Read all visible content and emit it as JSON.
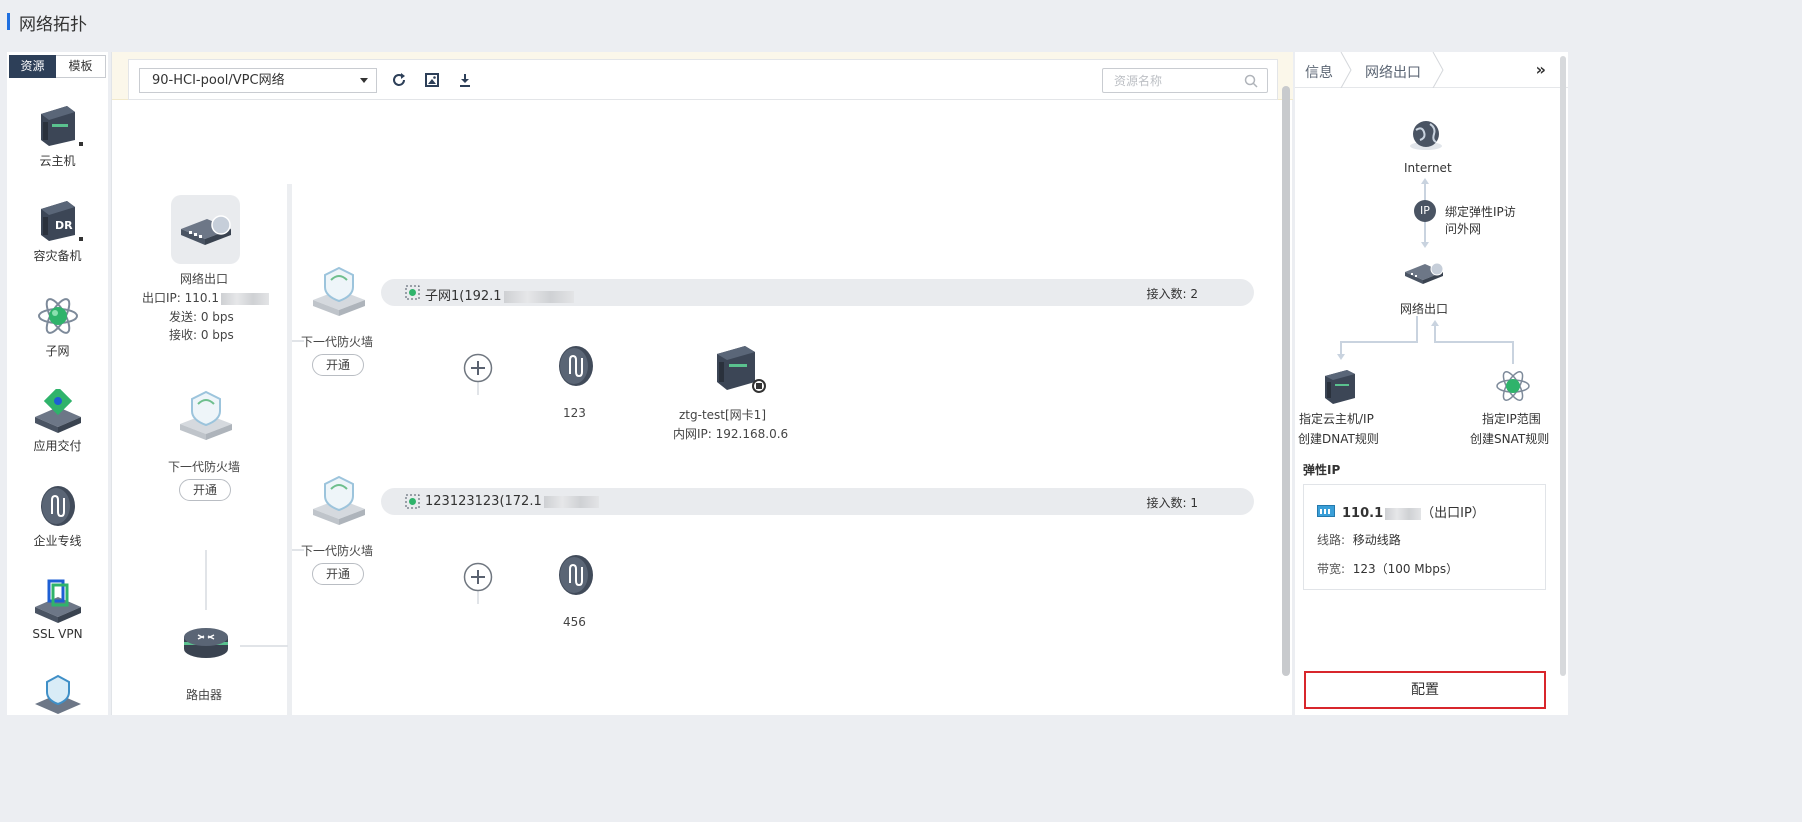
{
  "page": {
    "title": "网络拓扑"
  },
  "left": {
    "tabs": [
      {
        "label": "资源",
        "active": true
      },
      {
        "label": "模板",
        "active": false
      }
    ],
    "resources": [
      {
        "label": "云主机",
        "icon": "server-icon"
      },
      {
        "label": "容灾备机",
        "icon": "dr-server-icon"
      },
      {
        "label": "子网",
        "icon": "subnet-icon"
      },
      {
        "label": "应用交付",
        "icon": "app-delivery-icon"
      },
      {
        "label": "企业专线",
        "icon": "enterprise-line-icon"
      },
      {
        "label": "SSL VPN",
        "icon": "ssl-vpn-icon"
      }
    ]
  },
  "toolbar": {
    "select_value": "90-HCI-pool/VPC网络",
    "search_placeholder": "资源名称"
  },
  "topology": {
    "gateway": {
      "name": "网络出口",
      "ip_label": "出口IP: 110.1",
      "send": "发送:  0 bps",
      "recv": "接收:  0 bps"
    },
    "firewall_main": {
      "name": "下一代防火墙",
      "button": "开通"
    },
    "router": {
      "name": "路由器"
    },
    "subnets": [
      {
        "name": "子网1(192.1",
        "count": "接入数:  2",
        "firewall_name": "下一代防火墙",
        "firewall_button": "开通",
        "nodes": [
          {
            "label": "123",
            "icon": "enterprise-line-icon"
          },
          {
            "label": "ztg-test[网卡1]",
            "sub": "内网IP:  192.168.0.6",
            "icon": "server-icon"
          }
        ]
      },
      {
        "name": "123123123(172.1",
        "count": "接入数:  1",
        "firewall_name": "下一代防火墙",
        "firewall_button": "开通",
        "nodes": [
          {
            "label": "456",
            "icon": "enterprise-line-icon"
          }
        ]
      }
    ]
  },
  "right": {
    "breadcrumb": [
      "信息",
      "网络出口"
    ],
    "collapse": "»",
    "diagram": {
      "internet": "Internet",
      "ip_badge": "IP",
      "bind_text_1": "绑定弹性IP访",
      "bind_text_2": "问外网",
      "gateway": "网络出口",
      "dnat_1": "指定云主机/IP",
      "dnat_2": "创建DNAT规则",
      "snat_1": "指定IP范围",
      "snat_2": "创建SNAT规则"
    },
    "eip_title": "弹性IP",
    "eip": {
      "ip": "110.1",
      "ip_suffix": "（出口IP）",
      "line_label": "线路:",
      "line_value": "移动线路",
      "bw_label": "带宽:",
      "bw_value": "123（100 Mbps）"
    },
    "config_button": "配置"
  }
}
